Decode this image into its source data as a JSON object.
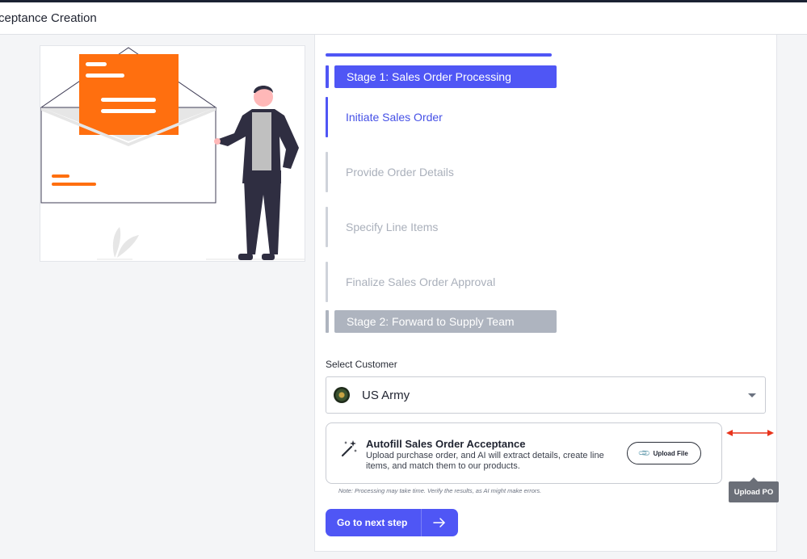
{
  "header": {
    "title": "ceptance Creation"
  },
  "stages": [
    {
      "label": "Stage 1: Sales Order Processing",
      "state": "active"
    },
    {
      "label": "Stage 2: Forward to Supply Team",
      "state": "inactive"
    }
  ],
  "steps": [
    {
      "label": "Initiate Sales Order",
      "state": "active"
    },
    {
      "label": "Provide Order Details",
      "state": "inactive"
    },
    {
      "label": "Specify Line Items",
      "state": "inactive"
    },
    {
      "label": "Finalize Sales Order Approval",
      "state": "inactive"
    }
  ],
  "customer": {
    "label": "Select Customer",
    "selected": "US Army",
    "logo_icon": "us-army-seal-icon"
  },
  "autofill": {
    "title": "Autofill Sales Order Acceptance",
    "description": "Upload purchase order, and AI will extract details, create line items, and match them to our products.",
    "upload_button": "Upload File",
    "upload_icon": "paperclip-icon",
    "wand_icon": "magic-wand-icon",
    "note": "Note: Processing may take time. Verify the results, as AI might make errors."
  },
  "tooltip": {
    "text": "Upload PO"
  },
  "next_button": {
    "label": "Go to next step",
    "icon": "arrow-right-icon"
  },
  "colors": {
    "accent": "#4f56f5",
    "inactive": "#aeb4bf",
    "illustration_orange": "#ff6f0f",
    "annotation_red": "#e8341c"
  }
}
